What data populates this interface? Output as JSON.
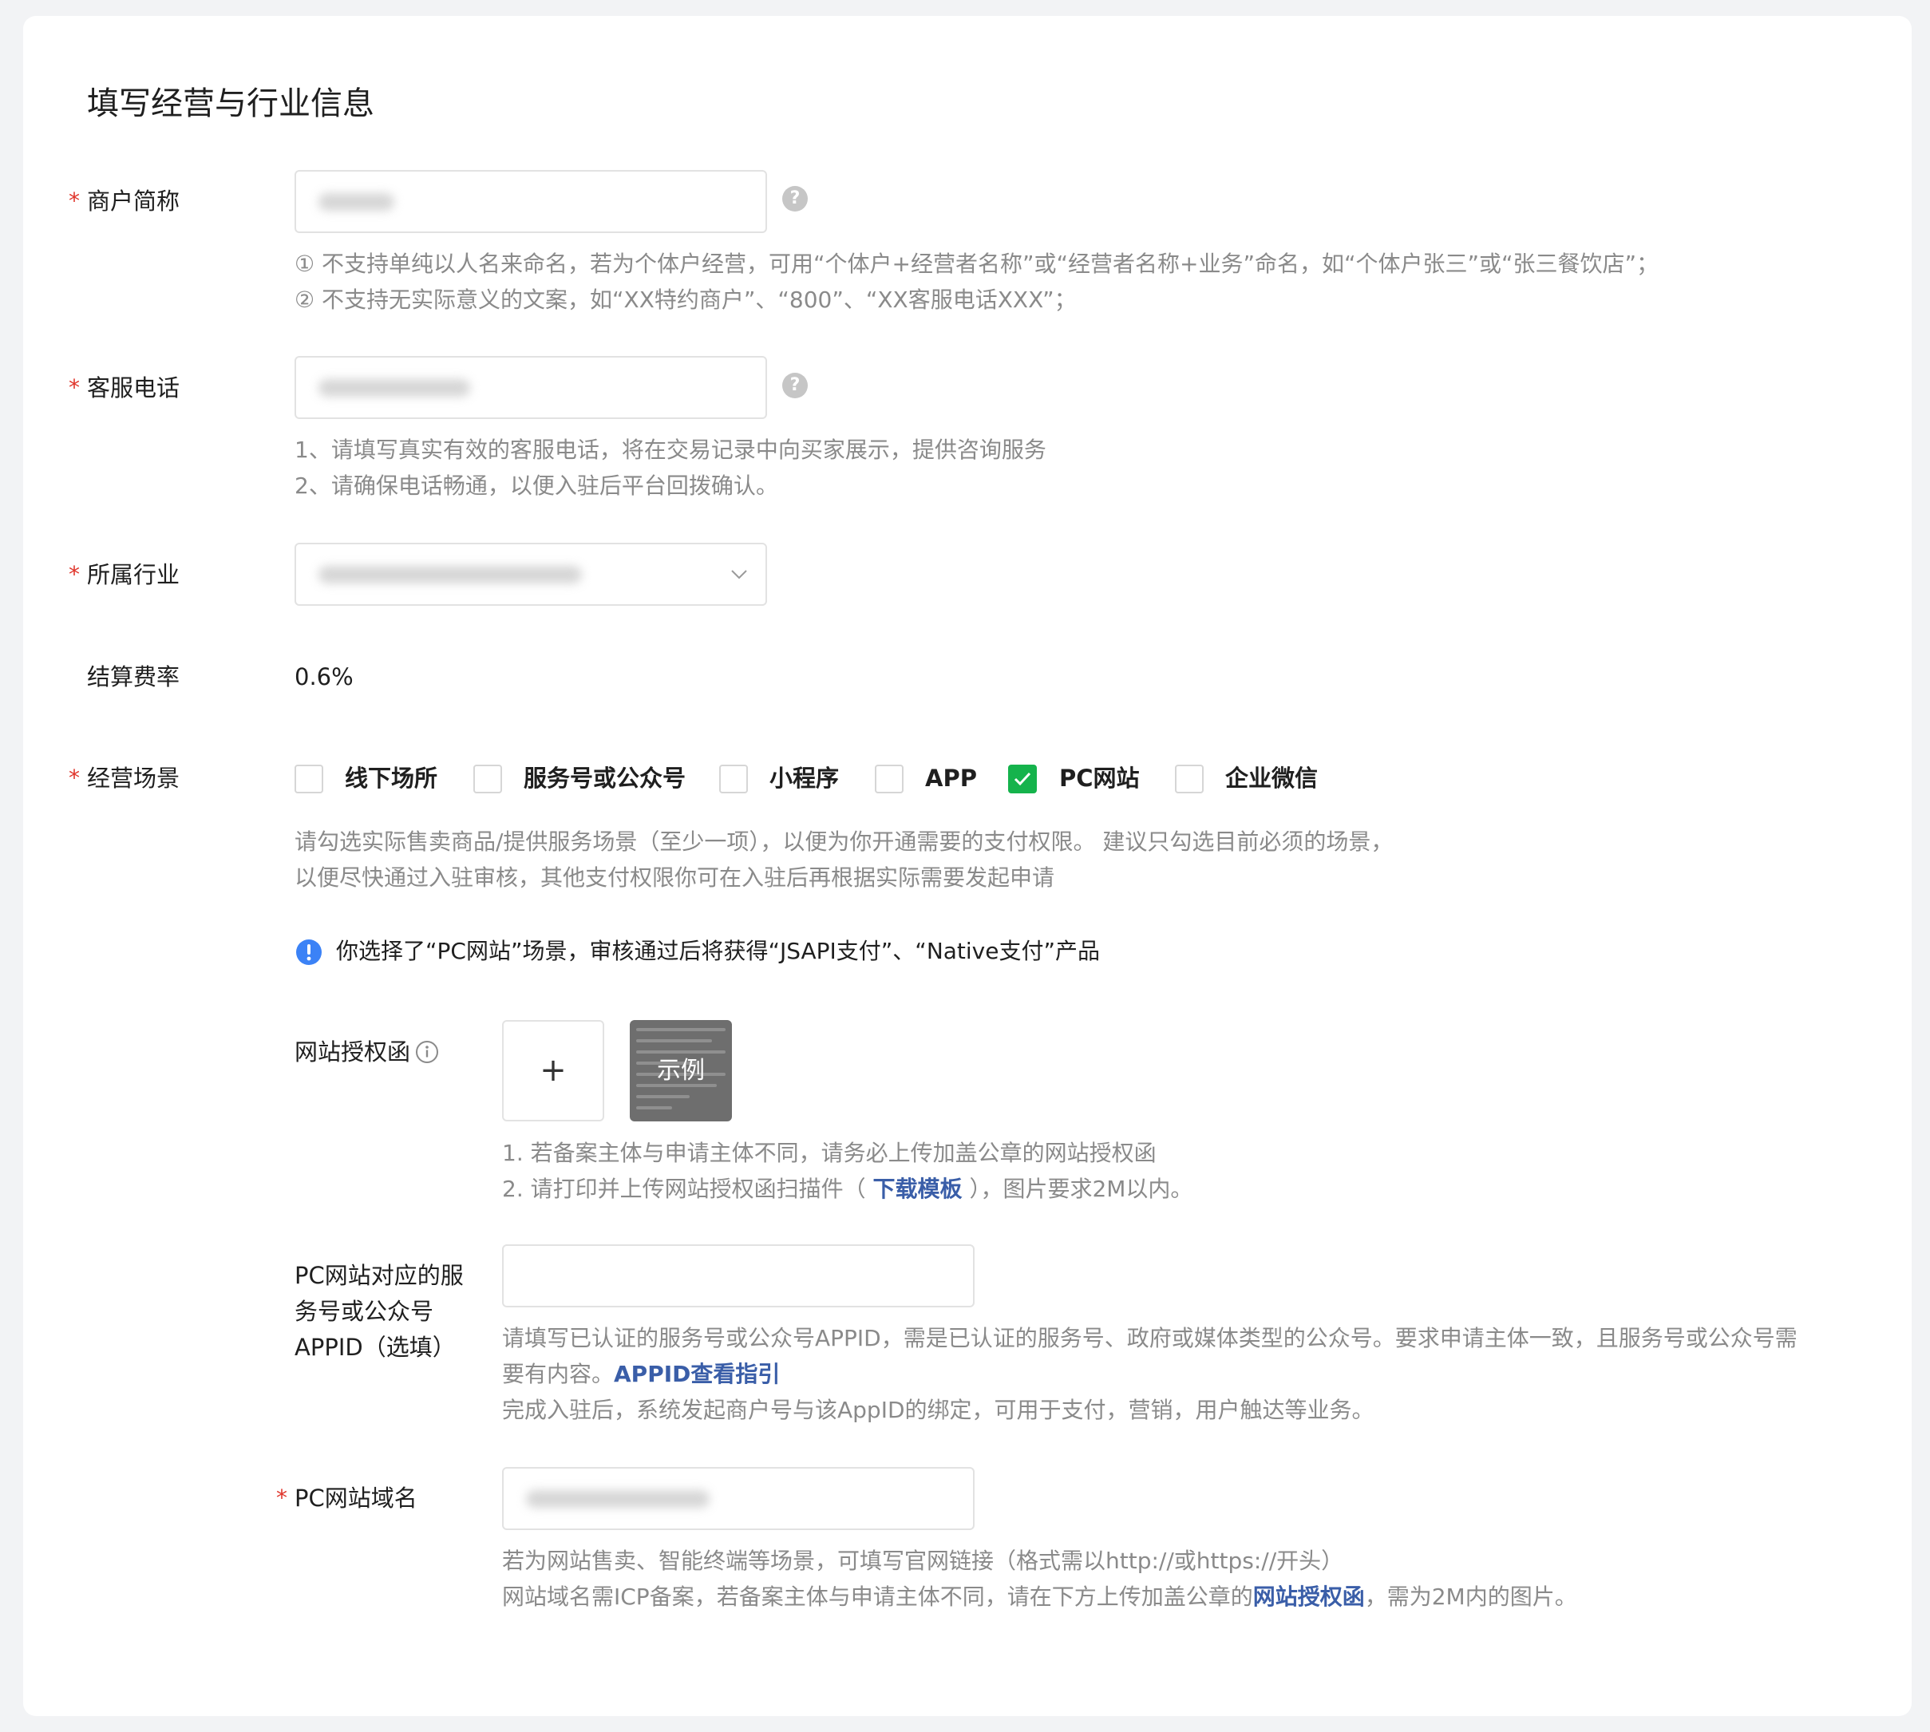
{
  "page": {
    "title": "填写经营与行业信息"
  },
  "merchant_name": {
    "required_mark": "*",
    "label": "商户简称",
    "help_icon": "question-circle-icon",
    "hints": [
      "① 不支持单纯以人名来命名，若为个体户经营，可用“个体户+经营者名称”或“经营者名称+业务”命名，如“个体户张三”或“张三餐饮店”；",
      "② 不支持无实际意义的文案，如“XX特约商户”、“800”、“XX客服电话XXX”；"
    ]
  },
  "service_phone": {
    "required_mark": "*",
    "label": "客服电话",
    "help_icon": "question-circle-icon",
    "hints": [
      "1、请填写真实有效的客服电话，将在交易记录中向买家展示，提供咨询服务",
      "2、请确保电话畅通，以便入驻后平台回拨确认。"
    ]
  },
  "industry": {
    "required_mark": "*",
    "label": "所属行业",
    "icon": "chevron-down-icon"
  },
  "settlement_rate": {
    "label": "结算费率",
    "value": "0.6%"
  },
  "scenes": {
    "required_mark": "*",
    "label": "经营场景",
    "options": [
      {
        "label": "线下场所",
        "checked": false
      },
      {
        "label": "服务号或公众号",
        "checked": false
      },
      {
        "label": "小程序",
        "checked": false
      },
      {
        "label": "APP",
        "checked": false
      },
      {
        "label": "PC网站",
        "checked": true
      },
      {
        "label": "企业微信",
        "checked": false
      }
    ],
    "hints": [
      "请勾选实际售卖商品/提供服务场景（至少一项），以便为你开通需要的支付权限。 建议只勾选目前必须的场景，",
      "以便尽快通过入驻审核，其他支付权限你可在入驻后再根据实际需要发起申请"
    ],
    "notice": "你选择了“PC网站”场景，审核通过后将获得“JSAPI支付”、“Native支付”产品",
    "notice_icon": "info-circle-icon",
    "check_color": "#15b34c",
    "notice_color": "#3b82f6"
  },
  "auth_letter": {
    "label": "网站授权函",
    "info_icon": "info-circle-outline-icon",
    "upload_symbol": "+",
    "sample_label": "示例",
    "hint_1": "1. 若备案主体与申请主体不同，请务必上传加盖公章的网站授权函",
    "hint_2_prefix": "2. 请打印并上传网站授权函扫描件（ ",
    "hint_2_link": "下载模板",
    "hint_2_suffix": " ），图片要求2M以内。"
  },
  "appid": {
    "label_lines": [
      "PC网站对应的服",
      "务号或公众号",
      "APPID（选填）"
    ],
    "hint_line_1": "请填写已认证的服务号或公众号APPID，需是已认证的服务号、政府或媒体类型的公众号。要求申请主体一致，且服务号或公众号需",
    "hint_line_2_prefix": "要有内容。",
    "hint_line_2_link": "APPID查看指引",
    "hint_line_3": "完成入驻后，系统发起商户号与该AppID的绑定，可用于支付，营销，用户触达等业务。"
  },
  "domain": {
    "required_mark": "*",
    "label": "PC网站域名",
    "hint_1": "若为网站售卖、智能终端等场景，可填写官网链接（格式需以http://或https://开头）",
    "hint_2_prefix": "网站域名需ICP备案，若备案主体与申请主体不同，请在下方上传加盖公章的",
    "hint_2_link": "网站授权函",
    "hint_2_suffix": "，需为2M内的图片。"
  },
  "colors": {
    "required": "#e0352b",
    "link": "#3a5ea8",
    "hint": "#8a8a8a"
  }
}
